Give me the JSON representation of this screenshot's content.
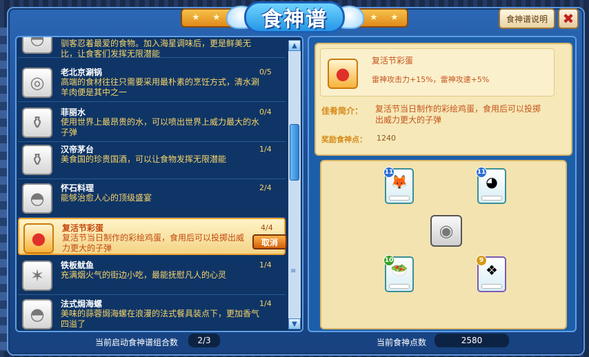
{
  "title": "食神谱",
  "help_button": "食神谱说明",
  "close_glyph": "✖",
  "recipes": [
    {
      "name": "",
      "count": "",
      "desc": "驯客忍着最爱的食物。加入海星调味后，更是鲜美无比，让食客们发挥无限潜能",
      "icon": "bowl-icon",
      "glyph": "◓"
    },
    {
      "name": "老北京涮锅",
      "count": "0/5",
      "desc": "高端的食材往往只需要采用最朴素的烹饪方式，清水涮羊肉便是其中之一",
      "icon": "hotpot-icon",
      "glyph": "◎"
    },
    {
      "name": "菲丽水",
      "count": "0/4",
      "desc": "使用世界上最昂贵的水，可以喷出世界上威力最大的水子弹",
      "icon": "water-bottle-icon",
      "glyph": "⚱"
    },
    {
      "name": "汉帝茅台",
      "count": "1/4",
      "desc": "美食国的珍贵国酒，可以让食物发挥无限潜能",
      "icon": "liquor-icon",
      "glyph": "⚱"
    },
    {
      "name": "怀石料理",
      "count": "2/4",
      "desc": "能够治愈人心的顶级盛宴",
      "icon": "kaiseki-icon",
      "glyph": "◓"
    },
    {
      "name": "复活节彩蛋",
      "count": "4/4",
      "desc": "复活节当日制作的彩绘鸡蛋，食用后可以投掷出威力更大的子弹",
      "icon": "easter-egg-icon",
      "glyph": "●"
    },
    {
      "name": "铁板鱿鱼",
      "count": "1/4",
      "desc": "充满烟火气的街边小吃，最能抚慰凡人的心灵",
      "icon": "squid-icon",
      "glyph": "✶"
    },
    {
      "name": "法式焗海螺",
      "count": "1/4",
      "desc": "美味的蒜蓉焗海螺在浪漫的法式餐具装点下，更加香气四溢了",
      "icon": "escargot-icon",
      "glyph": "◓"
    }
  ],
  "cancel_label": "取消",
  "scroll_up": "▲",
  "scroll_down": "▼",
  "scroll_grip": "≡",
  "left_footer": {
    "label": "当前启动食神谱组合数",
    "value": "2/3"
  },
  "detail": {
    "name": "复活节彩蛋",
    "effect": "雷神攻击力+15%，雷神攻速+5%",
    "desc_label": "佳肴简介：",
    "desc": "复活节当日制作的彩绘鸡蛋，食用后可以投掷出威力更大的子弹",
    "reward_label": "奖励食神点：",
    "reward_value": "1240",
    "icon": "easter-egg-icon",
    "glyph": "●"
  },
  "foods": [
    {
      "level": "11",
      "icon": "fox-food-icon",
      "glyph": "🦊",
      "level_color": "#2a6fd6"
    },
    {
      "level": "11",
      "icon": "blue-creature-food-icon",
      "glyph": "◕",
      "level_color": "#2a6fd6"
    },
    {
      "level": "10",
      "icon": "salad-food-icon",
      "glyph": "🥗",
      "level_color": "#3aa02a"
    },
    {
      "level": "9",
      "icon": "jelly-food-icon",
      "glyph": "❖",
      "level_color": "#d69a10"
    }
  ],
  "center_food": {
    "icon": "egg-plate-icon",
    "glyph": "◉"
  },
  "right_footer": {
    "label": "当前食神点数",
    "value": "2580"
  }
}
